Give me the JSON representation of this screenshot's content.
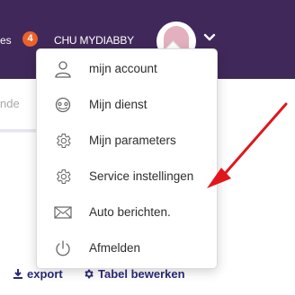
{
  "topbar": {
    "partial_label": "es",
    "badge_count": "4",
    "user_name": "CHU MYDIABBY"
  },
  "background": {
    "partial_tab": "nde"
  },
  "menu": {
    "items": [
      {
        "label": "mijn account",
        "icon": "user-icon"
      },
      {
        "label": "Mijn dienst",
        "icon": "service-icon"
      },
      {
        "label": "Mijn parameters",
        "icon": "gear-icon"
      },
      {
        "label": "Service instellingen",
        "icon": "gear-icon"
      },
      {
        "label": "Auto berichten.",
        "icon": "envelope-icon"
      },
      {
        "label": "Afmelden",
        "icon": "power-icon"
      }
    ]
  },
  "actions": {
    "export_label": "export",
    "edit_table_label": "Tabel bewerken"
  },
  "colors": {
    "topbar": "#41285a",
    "badge": "#e8622a",
    "arrow": "#e0161c",
    "action_text": "#2b2a7a"
  }
}
